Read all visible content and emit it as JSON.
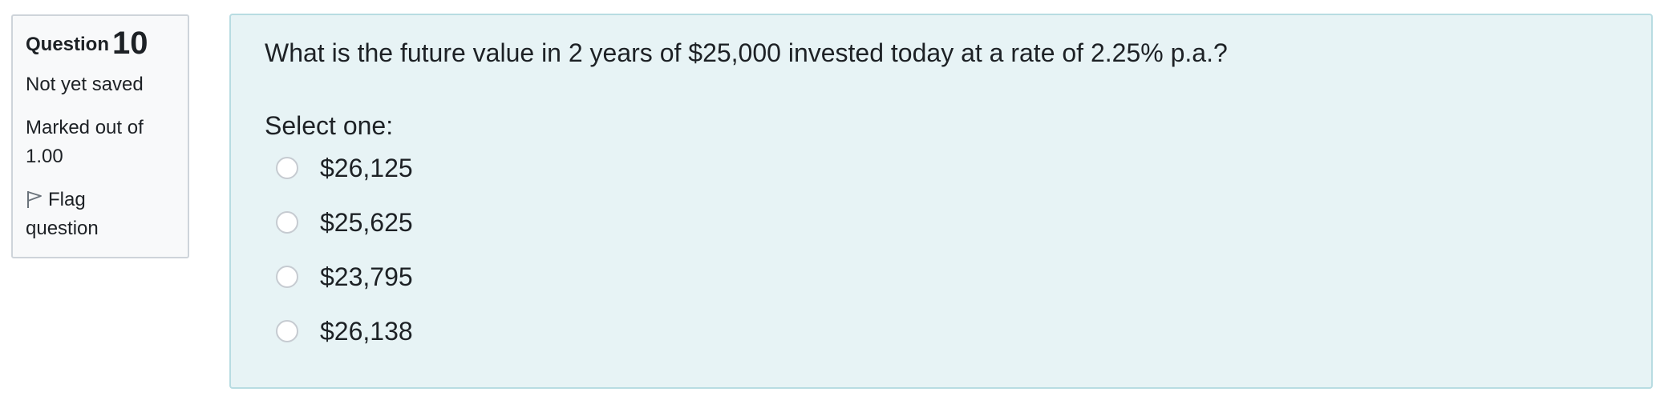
{
  "info": {
    "question_word": "Question",
    "question_number": "10",
    "state": "Not yet saved",
    "grade_line1": "Marked out of",
    "grade_line2": "1.00",
    "flag_line1": "Flag",
    "flag_line2": "question",
    "flag_icon": "flag-icon"
  },
  "question": {
    "text": "What is the future value in 2 years of $25,000 invested today at a rate of 2.25% p.a.?",
    "prompt": "Select one:",
    "answers": [
      {
        "label": "$26,125"
      },
      {
        "label": "$25,625"
      },
      {
        "label": "$23,795"
      },
      {
        "label": "$26,138"
      }
    ]
  },
  "colors": {
    "content_background": "#e7f3f5",
    "info_background": "#f8f9fa",
    "text": "#1d2125"
  }
}
